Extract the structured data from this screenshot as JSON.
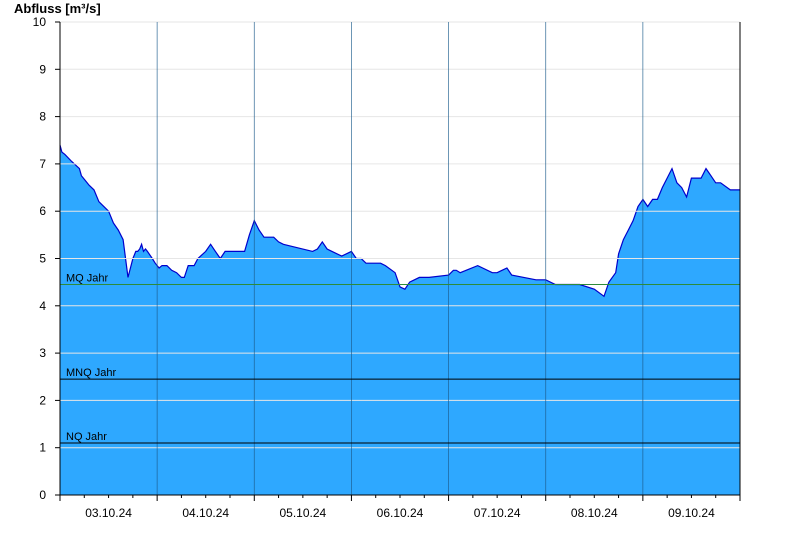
{
  "chart_data": {
    "type": "area",
    "ylabel": "Abfluss [m³/s]",
    "xlabel": "",
    "ylim": [
      0,
      10
    ],
    "yticks": [
      0,
      1,
      2,
      3,
      4,
      5,
      6,
      7,
      8,
      9,
      10
    ],
    "grid": true,
    "x_range_days": [
      0,
      7
    ],
    "x_tick_labels": [
      "03.10.24",
      "04.10.24",
      "05.10.24",
      "06.10.24",
      "07.10.24",
      "08.10.24",
      "09.10.24"
    ],
    "fill_color": "#2ea8ff",
    "line_color": "#0000cc",
    "reference_lines": [
      {
        "label": "MQ Jahr",
        "value": 4.45,
        "color": "#2e8b3a"
      },
      {
        "label": "MNQ Jahr",
        "value": 2.45,
        "color": "#000000"
      },
      {
        "label": "NQ Jahr",
        "value": 1.1,
        "color": "#000000"
      }
    ],
    "series": [
      {
        "x": [
          0.0,
          0.02,
          0.05,
          0.12,
          0.2,
          0.22,
          0.26,
          0.3,
          0.35,
          0.4,
          0.5,
          0.55,
          0.6,
          0.65,
          0.7,
          0.75,
          0.78,
          0.8,
          0.82,
          0.84,
          0.86,
          0.88,
          0.9,
          0.95,
          0.98,
          1.02,
          1.05,
          1.1,
          1.15,
          1.2,
          1.25,
          1.28,
          1.32,
          1.38,
          1.42,
          1.5,
          1.55,
          1.6,
          1.65,
          1.7,
          1.75,
          1.78,
          1.82,
          1.9,
          1.95,
          2.0,
          2.05,
          2.1,
          2.15,
          2.2,
          2.25,
          2.3,
          2.6,
          2.65,
          2.7,
          2.75,
          2.8,
          2.9,
          3.0,
          3.05,
          3.1,
          3.15,
          3.2,
          3.3,
          3.35,
          3.45,
          3.5,
          3.55,
          3.6,
          3.7,
          3.75,
          3.8,
          4.0,
          4.05,
          4.08,
          4.12,
          4.18,
          4.3,
          4.45,
          4.5,
          4.55,
          4.6,
          4.65,
          4.9,
          5.0,
          5.1,
          5.25,
          5.3,
          5.35,
          5.5,
          5.6,
          5.65,
          5.72,
          5.75,
          5.8,
          5.85,
          5.9,
          5.95,
          6.0,
          6.05,
          6.1,
          6.15,
          6.2,
          6.3,
          6.35,
          6.4,
          6.45,
          6.5,
          6.55,
          6.6,
          6.65,
          6.7,
          6.75,
          6.8,
          6.9,
          7.0
        ],
        "values": [
          7.4,
          7.25,
          7.2,
          7.05,
          6.9,
          6.75,
          6.65,
          6.55,
          6.45,
          6.2,
          6.0,
          5.75,
          5.6,
          5.4,
          4.6,
          5.0,
          5.15,
          5.15,
          5.2,
          5.3,
          5.15,
          5.2,
          5.15,
          5.0,
          4.9,
          4.8,
          4.85,
          4.85,
          4.75,
          4.7,
          4.6,
          4.6,
          4.85,
          4.85,
          5.0,
          5.15,
          5.3,
          5.15,
          5.0,
          5.15,
          5.15,
          5.15,
          5.15,
          5.15,
          5.5,
          5.8,
          5.6,
          5.45,
          5.45,
          5.45,
          5.35,
          5.3,
          5.15,
          5.2,
          5.35,
          5.2,
          5.15,
          5.05,
          5.15,
          5.0,
          5.0,
          4.9,
          4.9,
          4.9,
          4.85,
          4.7,
          4.4,
          4.35,
          4.5,
          4.6,
          4.6,
          4.6,
          4.65,
          4.75,
          4.75,
          4.7,
          4.75,
          4.85,
          4.7,
          4.7,
          4.75,
          4.8,
          4.65,
          4.55,
          4.55,
          4.45,
          4.45,
          4.45,
          4.45,
          4.35,
          4.2,
          4.5,
          4.7,
          5.1,
          5.4,
          5.6,
          5.8,
          6.1,
          6.25,
          6.1,
          6.25,
          6.25,
          6.5,
          6.9,
          6.6,
          6.5,
          6.3,
          6.7,
          6.7,
          6.7,
          6.9,
          6.75,
          6.6,
          6.6,
          6.45,
          6.45
        ]
      }
    ]
  }
}
